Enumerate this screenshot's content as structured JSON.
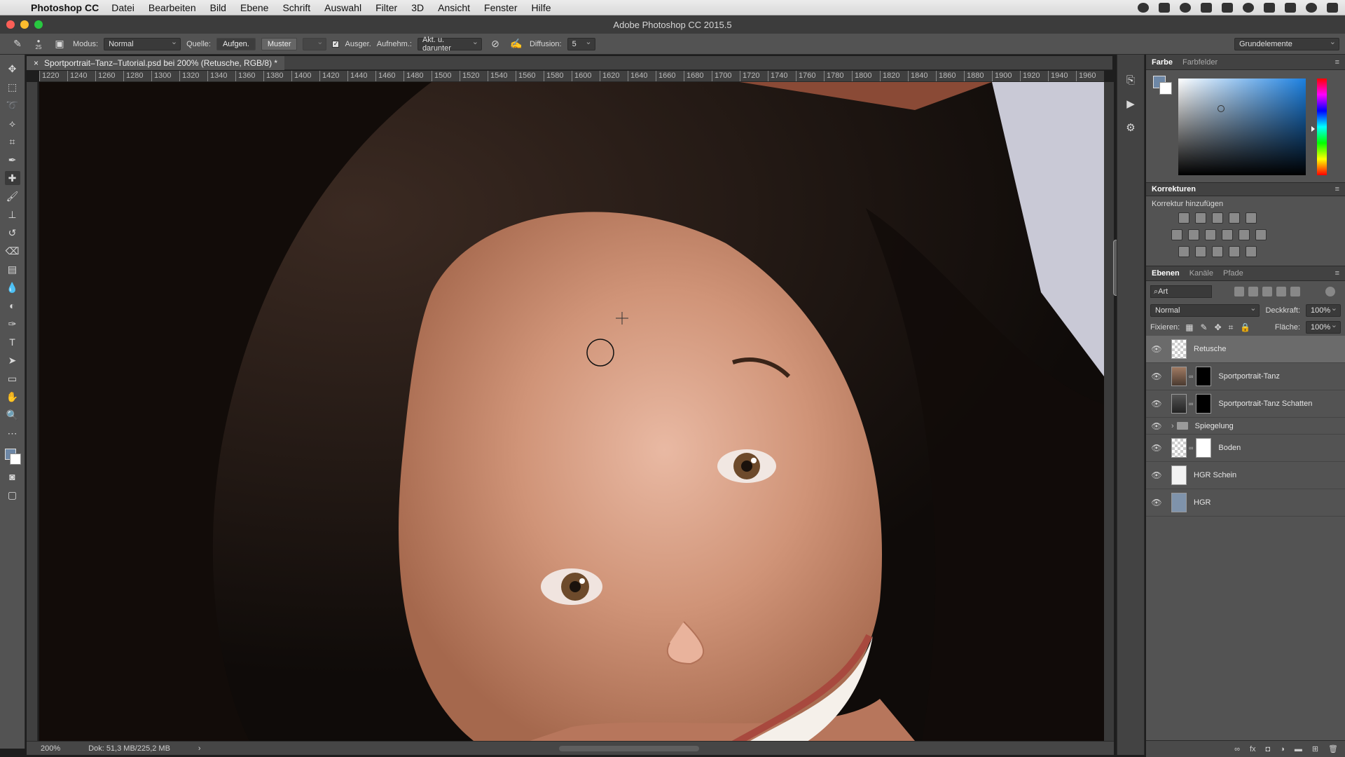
{
  "menubar": {
    "app": "Photoshop CC",
    "items": [
      "Datei",
      "Bearbeiten",
      "Bild",
      "Ebene",
      "Schrift",
      "Auswahl",
      "Filter",
      "3D",
      "Ansicht",
      "Fenster",
      "Hilfe"
    ]
  },
  "window": {
    "title": "Adobe Photoshop CC 2015.5"
  },
  "options": {
    "brush_size": "25",
    "mode_label": "Modus:",
    "mode_value": "Normal",
    "source_label": "Quelle:",
    "source_btn1": "Aufgen.",
    "source_btn2": "Muster",
    "aligned_label": "Ausger.",
    "sample_label": "Aufnehm.:",
    "sample_value": "Akt. u. darunter",
    "diffusion_label": "Diffusion:",
    "diffusion_value": "5",
    "workspace": "Grundelemente"
  },
  "document": {
    "tab_title": "Sportportrait–Tanz–Tutorial.psd bei 200% (Retusche, RGB/8) *",
    "ruler_ticks": [
      "1220",
      "1240",
      "1260",
      "1280",
      "1300",
      "1320",
      "1340",
      "1360",
      "1380",
      "1400",
      "1420",
      "1440",
      "1460",
      "1480",
      "1500",
      "1520",
      "1540",
      "1560",
      "1580",
      "1600",
      "1620",
      "1640",
      "1660",
      "1680",
      "1700",
      "1720",
      "1740",
      "1760",
      "1780",
      "1800",
      "1820",
      "1840",
      "1860",
      "1880",
      "1900",
      "1920",
      "1940",
      "1960"
    ]
  },
  "status": {
    "zoom": "200%",
    "doc_size": "Dok: 51,3 MB/225,2 MB"
  },
  "color_panel": {
    "tabs": [
      "Farbe",
      "Farbfelder"
    ],
    "fg_color": "#6d87a6"
  },
  "adjustments": {
    "title": "Korrekturen",
    "subtitle": "Korrektur hinzufügen"
  },
  "layers_panel": {
    "tabs": [
      "Ebenen",
      "Kanäle",
      "Pfade"
    ],
    "search": "Art",
    "blend": "Normal",
    "opacity_label": "Deckkraft:",
    "opacity": "100%",
    "lock_label": "Fixieren:",
    "fill_label": "Fläche:",
    "fill": "100%",
    "layers": [
      {
        "name": "Retusche",
        "selected": true
      },
      {
        "name": "Sportportrait-Tanz"
      },
      {
        "name": "Sportportrait-Tanz Schatten"
      },
      {
        "name": "Spiegelung",
        "group": true
      },
      {
        "name": "Boden"
      },
      {
        "name": "HGR Schein"
      },
      {
        "name": "HGR"
      }
    ]
  }
}
